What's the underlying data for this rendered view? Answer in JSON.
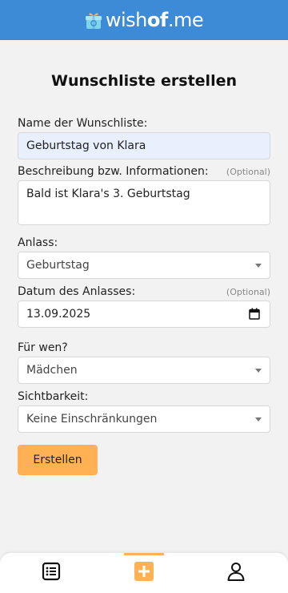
{
  "app": {
    "logo_text_regular": "wish",
    "logo_text_bold": "of",
    "logo_text_end": ".me"
  },
  "page": {
    "title": "Wunschliste erstellen"
  },
  "form": {
    "name": {
      "label": "Name der Wunschliste:",
      "value": "Geburtstag von Klara"
    },
    "description": {
      "label": "Beschreibung bzw. Informationen:",
      "optional": "(Optional)",
      "value": "Bald ist Klara's 3. Geburtstag"
    },
    "occasion": {
      "label": "Anlass:",
      "value": "Geburtstag"
    },
    "date": {
      "label": "Datum des Anlasses:",
      "optional": "(Optional)",
      "value": "13.09.2025"
    },
    "recipient": {
      "label": "Für wen?",
      "value": "Mädchen"
    },
    "visibility": {
      "label": "Sichtbarkeit:",
      "value": "Keine Einschränkungen"
    },
    "submit_label": "Erstellen"
  },
  "nav": {
    "items": [
      {
        "icon": "list-icon",
        "active": false
      },
      {
        "icon": "plus-icon",
        "active": true
      },
      {
        "icon": "user-icon",
        "active": false
      }
    ],
    "accent": "#ffb154"
  },
  "colors": {
    "header": "#3d8bd6",
    "accent": "#ffb154",
    "autofill": "#e8f0fe"
  }
}
